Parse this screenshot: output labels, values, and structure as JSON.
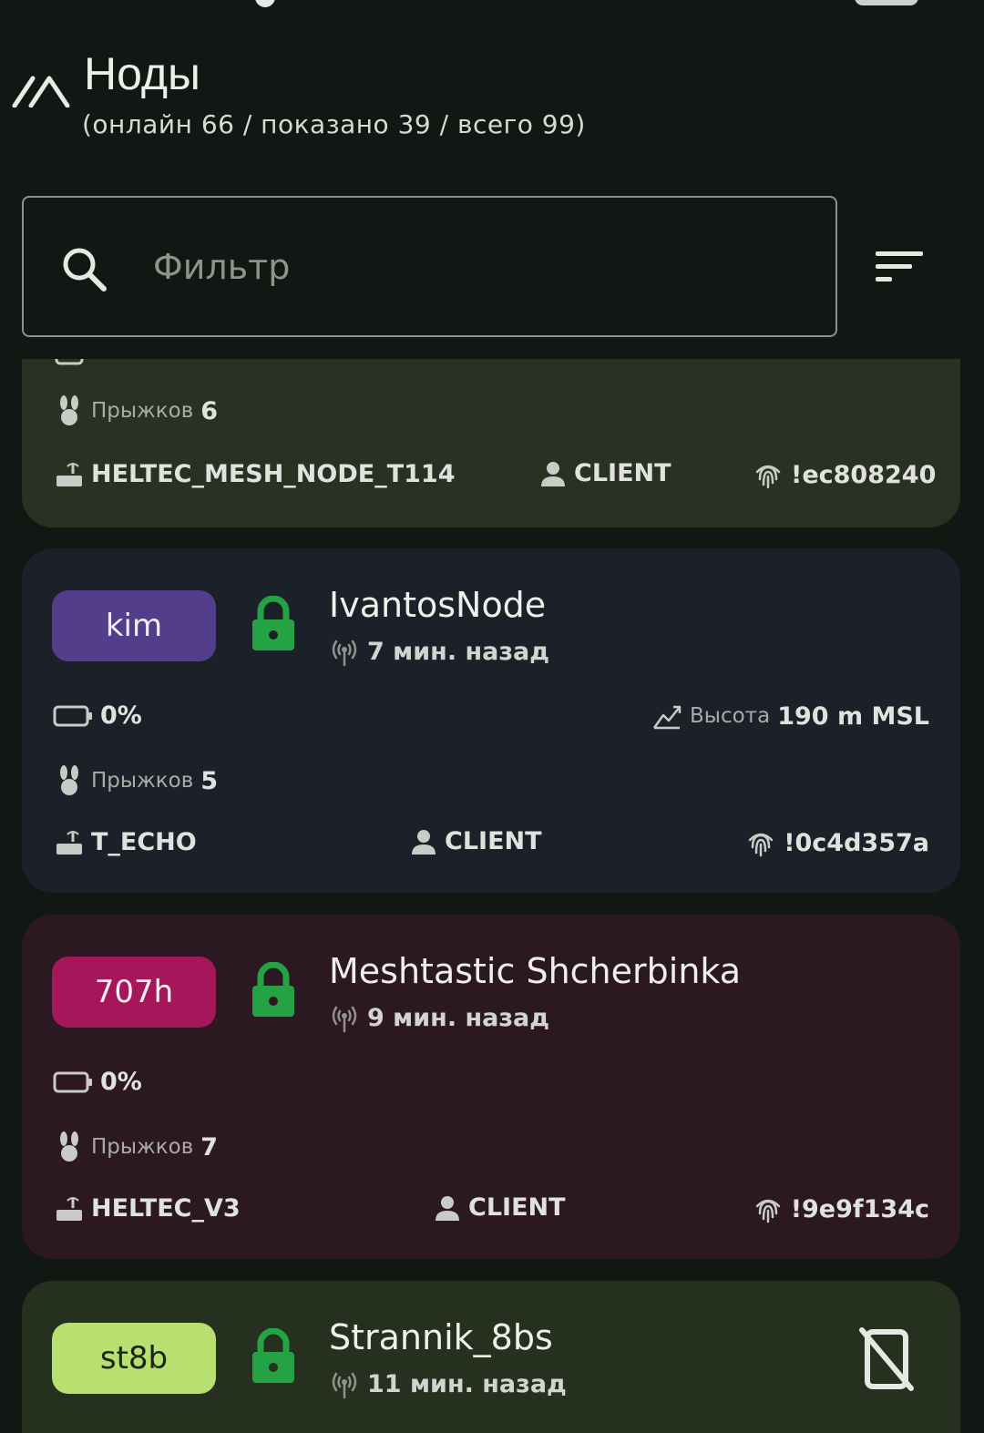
{
  "header": {
    "title": "Ноды",
    "subtitle": "(онлайн 66 / показано 39 / всего 99)"
  },
  "filter": {
    "placeholder": "Фильтр"
  },
  "nodes": [
    {
      "hops_label": "Прыжков",
      "hops": "6",
      "hardware": "HELTEC_MESH_NODE_T114",
      "role": "CLIENT",
      "id": "!ec808240"
    },
    {
      "short": "kim",
      "short_color": "#533e8c",
      "long": "IvantosNode",
      "last_heard": "7 мин. назад",
      "battery": "0%",
      "altitude_label": "Высота",
      "altitude": "190 m MSL",
      "hops_label": "Прыжков",
      "hops": "5",
      "hardware": "T_ECHO",
      "role": "CLIENT",
      "id": "!0c4d357a"
    },
    {
      "short": "707h",
      "short_color": "#a5165a",
      "long": "Meshtastic Shcherbinka",
      "last_heard": "9 мин. назад",
      "battery": "0%",
      "hops_label": "Прыжков",
      "hops": "7",
      "hardware": "HELTEC_V3",
      "role": "CLIENT",
      "id": "!9e9f134c"
    },
    {
      "short": "st8b",
      "short_color": "#b8e070",
      "long": "Strannik_8bs",
      "last_heard": "11 мин. назад"
    }
  ],
  "colors": {
    "background": "#111712",
    "lock": "#25a244",
    "card_green": "#2b3122",
    "card_blue": "#1c2029",
    "card_red": "#2c1820"
  }
}
